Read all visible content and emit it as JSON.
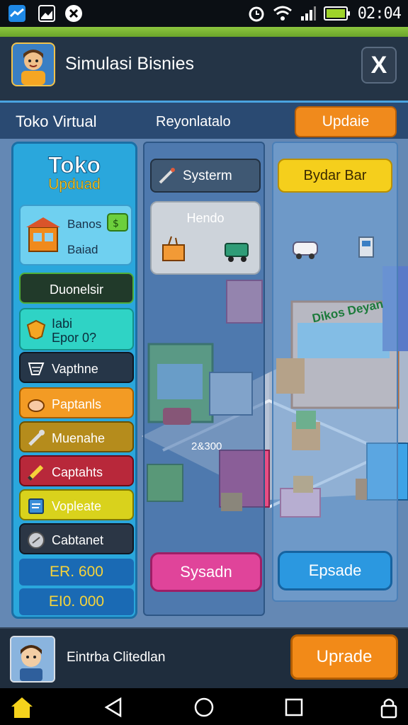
{
  "status_bar": {
    "time": "02:04",
    "icons": [
      "app-icon-blue",
      "gallery-icon",
      "compass-icon",
      "alarm-icon",
      "wifi-icon",
      "signal-icon",
      "battery-icon"
    ]
  },
  "header": {
    "title": "Simulasi Bisnies",
    "close_label": "X"
  },
  "subheader": {
    "tab1": "Toko Virtual",
    "tab2": "Reyonlatalo",
    "update_label": "Updaie"
  },
  "left_panel": {
    "title": "Toko",
    "subtitle": "Upduad",
    "card": {
      "line1": "Banos",
      "line2": "Baiad"
    },
    "items": [
      {
        "label": "Duonelsir",
        "color": "#213a2a"
      },
      {
        "label": "Iabi\nEpor 0?",
        "color": "#2fd3c5"
      },
      {
        "label": "Vapthne",
        "color": "#263648"
      },
      {
        "label": "Paptanls",
        "color": "#f39b24"
      },
      {
        "label": "Muenahe",
        "color": "#b58c1c"
      },
      {
        "label": "Captahts",
        "color": "#b8283a"
      },
      {
        "label": "Vopleate",
        "color": "#d9d21c"
      },
      {
        "label": "Cabtanet",
        "color": "#2b3645"
      }
    ],
    "money": [
      "ER. 600",
      "EI0. 000"
    ]
  },
  "mid_panel": {
    "system_label": "Systerm",
    "vend_label": "Hendo",
    "price_label": "2&300",
    "action_label": "Sysadn"
  },
  "right_panel": {
    "top_label": "Bydar Bar",
    "shop_sign": "Dikos Deyan",
    "action_label": "Epsade"
  },
  "bottom_bar": {
    "name": "Eintrba Clitedlan",
    "upgrade_label": "Uprade"
  },
  "nav": [
    "home-icon",
    "back-icon",
    "home-circle-icon",
    "recents-icon",
    "lock-icon"
  ],
  "colors": {
    "accent_orange": "#f28a18",
    "accent_blue": "#2b98e0",
    "accent_pink": "#e0449a",
    "accent_yellow": "#f5cf1c"
  }
}
